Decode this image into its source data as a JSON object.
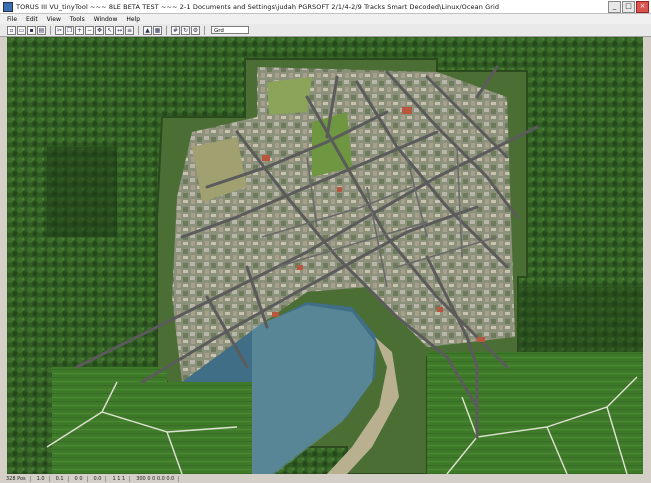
{
  "window": {
    "title": "TORUS III  VU_tinyTool  ~~~ 8LE BETA TEST ~~~  2-1 Documents and Settings\\judah PGRSOFT 2/1/4-2/9 Tracks Smart Decoded\\Linux/Ocean Grid",
    "minimize_label": "_",
    "maximize_label": "□",
    "close_label": "×"
  },
  "menu": {
    "items": [
      "File",
      "Edit",
      "View",
      "Tools",
      "Window",
      "Help"
    ]
  },
  "toolbar": {
    "select_value": "Grd",
    "button_icons": [
      "new-icon",
      "open-icon",
      "save-icon",
      "print-icon",
      "cut-icon",
      "copy-icon",
      "zoom-in-icon",
      "zoom-out-icon",
      "pan-icon",
      "select-icon",
      "measure-icon",
      "layer-icon",
      "terrain-icon",
      "texture-icon",
      "grid-icon",
      "refresh-icon",
      "settings-icon"
    ]
  },
  "status": {
    "cells": [
      "328 Pos",
      "1.0",
      "0.1",
      "0 0",
      "0.0",
      "1 1 1",
      "300 0 0  0.0 0.0"
    ]
  },
  "colors": {
    "forest": "#2f5a22",
    "forest_dark": "#1e3d17",
    "field": "#4a7a2c",
    "town": "#8a8f7a",
    "road": "#5b5b5b",
    "water": "#3f6e86",
    "water_light": "#6d9aa5"
  }
}
